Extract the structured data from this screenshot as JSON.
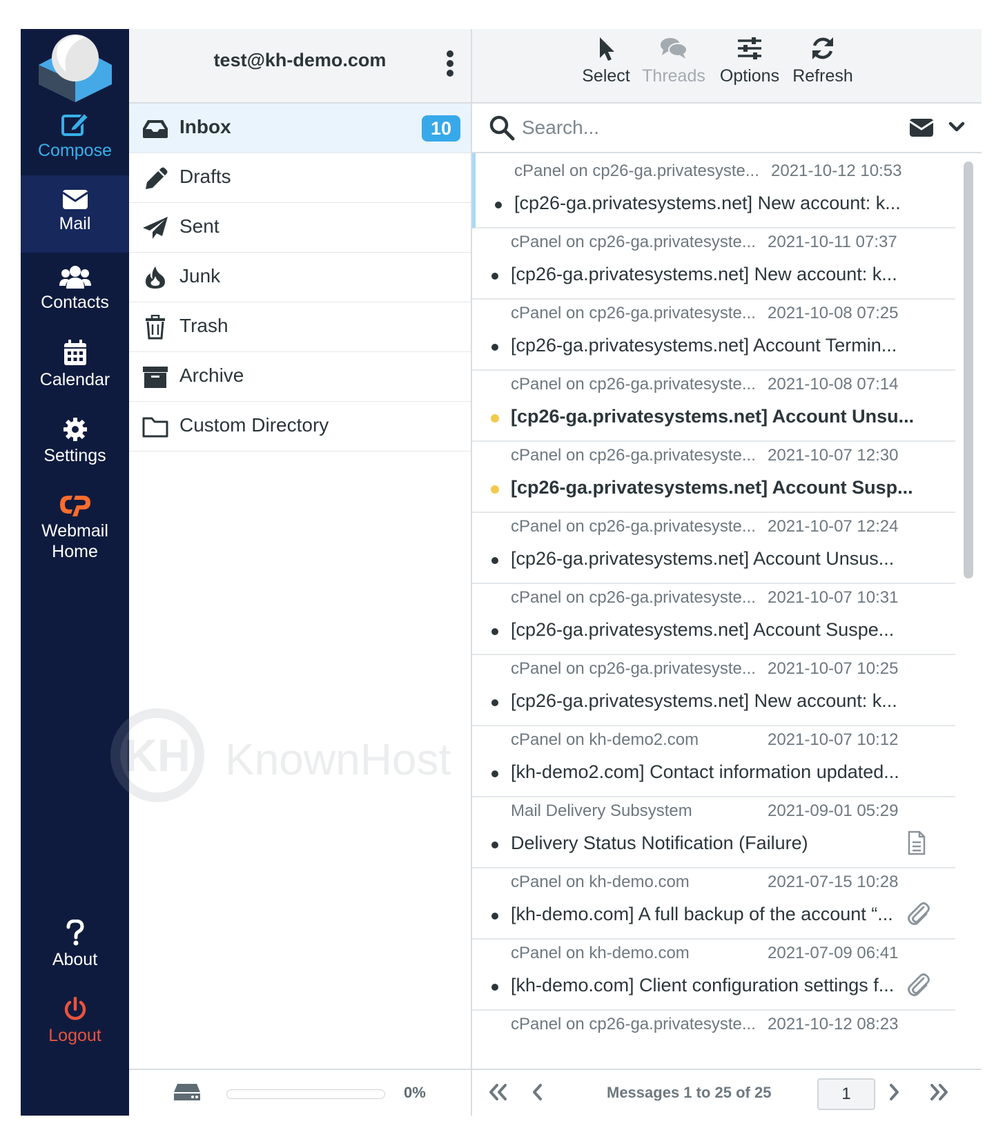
{
  "account": {
    "email": "test@kh-demo.com"
  },
  "nav": {
    "compose": "Compose",
    "mail": "Mail",
    "contacts": "Contacts",
    "calendar": "Calendar",
    "settings": "Settings",
    "webmail_home_line1": "Webmail",
    "webmail_home_line2": "Home",
    "about": "About",
    "logout": "Logout"
  },
  "folders": [
    {
      "label": "Inbox",
      "icon": "inbox-icon",
      "unread": "10",
      "selected": true
    },
    {
      "label": "Drafts",
      "icon": "pencil-icon"
    },
    {
      "label": "Sent",
      "icon": "paper-plane-icon"
    },
    {
      "label": "Junk",
      "icon": "fire-icon"
    },
    {
      "label": "Trash",
      "icon": "trash-icon"
    },
    {
      "label": "Archive",
      "icon": "archive-icon"
    },
    {
      "label": "Custom Directory",
      "icon": "folder-icon"
    }
  ],
  "quota": {
    "percent_label": "0%",
    "fraction": 0
  },
  "toolbar": {
    "select": "Select",
    "threads": "Threads",
    "options": "Options",
    "refresh": "Refresh"
  },
  "search": {
    "placeholder": "Search..."
  },
  "messages": [
    {
      "from": "cPanel on cp26-ga.privatesyste...",
      "date": "2021-10-12 10:53",
      "subject": "[cp26-ga.privatesystems.net] New account: k...",
      "unread": false,
      "flagged": false,
      "attachment": ""
    },
    {
      "from": "cPanel on cp26-ga.privatesyste...",
      "date": "2021-10-11 07:37",
      "subject": "[cp26-ga.privatesystems.net] New account: k...",
      "unread": false,
      "flagged": false,
      "attachment": ""
    },
    {
      "from": "cPanel on cp26-ga.privatesyste...",
      "date": "2021-10-08 07:25",
      "subject": "[cp26-ga.privatesystems.net] Account Termin...",
      "unread": false,
      "flagged": false,
      "attachment": ""
    },
    {
      "from": "cPanel on cp26-ga.privatesyste...",
      "date": "2021-10-08 07:14",
      "subject": "[cp26-ga.privatesystems.net] Account Unsu...",
      "unread": true,
      "flagged": true,
      "attachment": ""
    },
    {
      "from": "cPanel on cp26-ga.privatesyste...",
      "date": "2021-10-07 12:30",
      "subject": "[cp26-ga.privatesystems.net] Account Susp...",
      "unread": true,
      "flagged": true,
      "attachment": ""
    },
    {
      "from": "cPanel on cp26-ga.privatesyste...",
      "date": "2021-10-07 12:24",
      "subject": "[cp26-ga.privatesystems.net] Account Unsus...",
      "unread": false,
      "flagged": false,
      "attachment": ""
    },
    {
      "from": "cPanel on cp26-ga.privatesyste...",
      "date": "2021-10-07 10:31",
      "subject": "[cp26-ga.privatesystems.net] Account Suspe...",
      "unread": false,
      "flagged": false,
      "attachment": ""
    },
    {
      "from": "cPanel on cp26-ga.privatesyste...",
      "date": "2021-10-07 10:25",
      "subject": "[cp26-ga.privatesystems.net] New account: k...",
      "unread": false,
      "flagged": false,
      "attachment": ""
    },
    {
      "from": "cPanel on kh-demo2.com",
      "date": "2021-10-07 10:12",
      "subject": "[kh-demo2.com] Contact information updated...",
      "unread": false,
      "flagged": false,
      "attachment": ""
    },
    {
      "from": "Mail Delivery Subsystem",
      "date": "2021-09-01 05:29",
      "subject": "Delivery Status Notification (Failure)",
      "unread": false,
      "flagged": false,
      "attachment": "report"
    },
    {
      "from": "cPanel on kh-demo.com",
      "date": "2021-07-15 10:28",
      "subject": "[kh-demo.com] A full backup of the account “...",
      "unread": false,
      "flagged": false,
      "attachment": "paperclip"
    },
    {
      "from": "cPanel on kh-demo.com",
      "date": "2021-07-09 06:41",
      "subject": "[kh-demo.com] Client configuration settings f...",
      "unread": false,
      "flagged": false,
      "attachment": "paperclip"
    },
    {
      "from": "cPanel on cp26-ga.privatesyste...",
      "date": "2021-10-12 08:23",
      "subject": "",
      "unread": false,
      "flagged": false,
      "attachment": ""
    }
  ],
  "pagination": {
    "count_label": "Messages 1 to 25 of 25",
    "page": "1"
  },
  "watermark": {
    "text": "KnownHost",
    "monogram": "KH"
  },
  "colors": {
    "nav_bg": "#0f1b3e",
    "nav_active": "#16285c",
    "accent": "#37a9ea",
    "logout": "#e8533f",
    "cpanel_orange": "#ff6c2c",
    "flag": "#f3c94c"
  }
}
